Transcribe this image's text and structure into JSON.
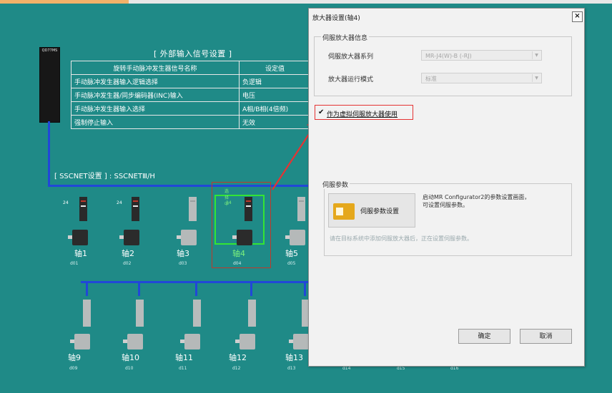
{
  "colors": {
    "workspace_bg": "#1f8a87",
    "bus": "#2147d8",
    "highlight_red": "#e53333",
    "highlight_green": "#33e533",
    "dialog_bg": "#f2f2f2"
  },
  "controller": {
    "label": "QD77MS"
  },
  "external_settings": {
    "title": "[ 外部输入信号设置 ]",
    "columns": [
      "旋转手动脉冲发生器信号名称",
      "设定值"
    ],
    "rows": [
      [
        "手动脉冲发生器输入逻辑选择",
        "负逻辑"
      ],
      [
        "手动脉冲发生器/同步编码器(INC)输入",
        "电压"
      ],
      [
        "手动脉冲发生器输入选择",
        "A相/B相(4倍频)"
      ],
      [
        "强制停止输入",
        "无效"
      ]
    ]
  },
  "sscnet": {
    "label": "[ SSCNET设置 ] : SSCNETⅢ/H"
  },
  "axes_top": [
    {
      "label": "轴1",
      "station": "d01",
      "number": "24"
    },
    {
      "label": "轴2",
      "station": "d02",
      "number": "24"
    },
    {
      "label": "轴3",
      "station": "d03",
      "number": ""
    },
    {
      "label": "轴4",
      "station": "d04",
      "number": "24",
      "tag": "选择中"
    },
    {
      "label": "轴5",
      "station": "d05",
      "number": ""
    }
  ],
  "axes_bottom": [
    {
      "label": "轴9",
      "station": "d09"
    },
    {
      "label": "轴10",
      "station": "d10"
    },
    {
      "label": "轴11",
      "station": "d11"
    },
    {
      "label": "轴12",
      "station": "d12"
    },
    {
      "label": "轴13",
      "station": "d13"
    }
  ],
  "bottom_extra_stations": [
    "d14",
    "d15",
    "d16"
  ],
  "dialog": {
    "title": "放大器设置(轴4)",
    "close_label": "×",
    "amp_info_group": "伺服放大器信息",
    "amp_series_label": "伺服放大器系列",
    "amp_series_value": "MR-J4(W)-B (-RJ)",
    "amp_mode_label": "放大器运行模式",
    "amp_mode_value": "标准",
    "virtual_amp_checked": true,
    "virtual_amp_check": "✔",
    "virtual_amp_label": "作为虚拟伺服放大器使用",
    "servo_param_group": "伺服参数",
    "servo_param_button": "伺服参数设置",
    "servo_param_desc": "启动MR Configurator2的参数设置画面，\n可设置伺服参数。",
    "servo_param_note": "请在目标系统中添加伺服放大器后，正在设置伺服参数。",
    "ok_label": "确定",
    "cancel_label": "取消"
  }
}
